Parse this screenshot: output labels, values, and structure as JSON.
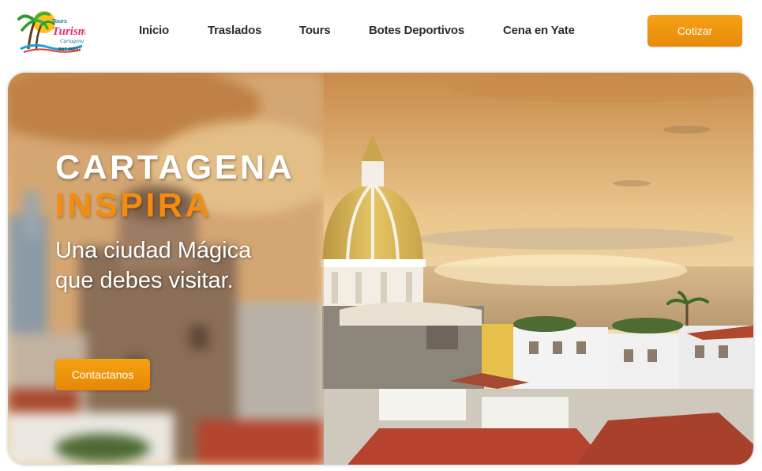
{
  "brand": {
    "logo_title": "Turismo",
    "logo_small_top": "Tours",
    "logo_small_right": "Cartagena",
    "logo_tiny": "RNT 86897"
  },
  "nav": {
    "items": [
      {
        "label": "Inicio"
      },
      {
        "label": "Traslados"
      },
      {
        "label": "Tours"
      },
      {
        "label": "Botes Deportivos"
      },
      {
        "label": "Cena en Yate"
      }
    ],
    "cta_label": "Cotizar"
  },
  "hero": {
    "title_line1": "CARTAGENA",
    "title_line2": "INSPIRA",
    "subtitle": "Una ciudad Mágica que debes visitar.",
    "button_label": "Contactanos"
  },
  "colors": {
    "accent": "#f08c0c",
    "text_dark": "#2c2c2c",
    "white": "#ffffff"
  }
}
